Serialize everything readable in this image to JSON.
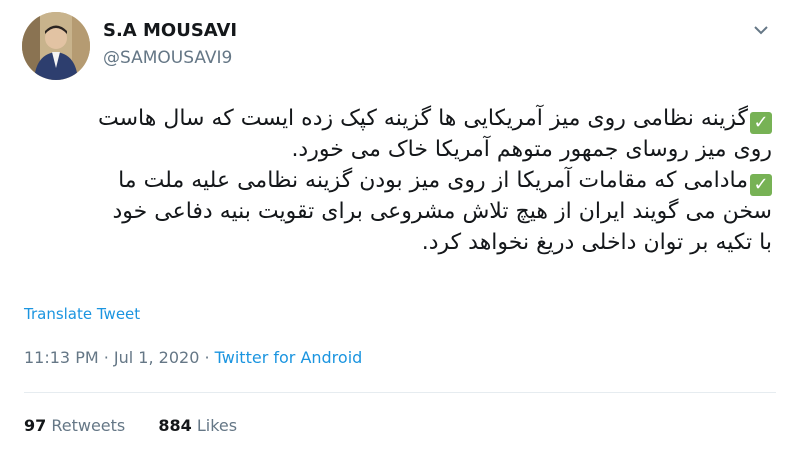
{
  "author": {
    "name": "S.A MOUSAVI",
    "handle": "@SAMOUSAVI9",
    "avatar_icon": "profile-photo"
  },
  "tweet": {
    "line1": "گزینه نظامی روی میز آمریکایی ها گزینه کپک زده ایست که سال هاست",
    "line2": "روی میز روسای جمهور متوهم آمریکا خاک می خورد.",
    "line3": "مادامی که مقامات آمریکا از روی میز بودن گزینه نظامی علیه ملت ما",
    "line4": "سخن می گویند ایران از هیچ تلاش مشروعی برای تقویت بنیه دفاعی خود",
    "line5": "با تکیه بر توان داخلی دریغ نخواهد کرد.",
    "check_icon": "green-checkmark"
  },
  "translate_label": "Translate Tweet",
  "meta": {
    "timestamp": "11:13 PM · Jul 1, 2020",
    "separator": " · ",
    "source": "Twitter for Android"
  },
  "stats": {
    "retweets_count": "97",
    "retweets_label": "Retweets",
    "likes_count": "884",
    "likes_label": "Likes"
  },
  "colors": {
    "link": "#1b95e0",
    "secondary": "#657786",
    "check": "#77b255"
  }
}
